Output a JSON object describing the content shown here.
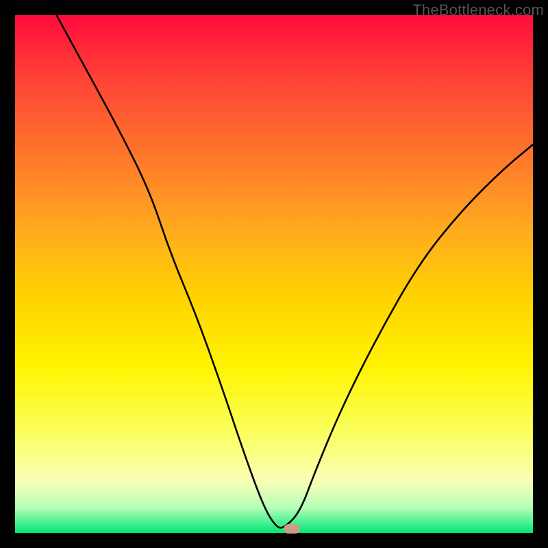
{
  "watermark": "TheBottleneck.com",
  "marker": {
    "x_frac": 0.535,
    "y_frac": 0.992
  },
  "chart_data": {
    "type": "line",
    "title": "",
    "xlabel": "",
    "ylabel": "",
    "xlim": [
      0,
      100
    ],
    "ylim": [
      0,
      100
    ],
    "grid": false,
    "legend": false,
    "series": [
      {
        "name": "bottleneck-curve",
        "x": [
          8,
          14,
          20,
          26,
          30,
          35,
          40,
          44,
          48,
          50.5,
          52,
          55,
          58,
          63,
          70,
          78,
          86,
          94,
          100
        ],
        "y": [
          100,
          89,
          78,
          66,
          54,
          42,
          28,
          16,
          5,
          1,
          1,
          4,
          12,
          24,
          38,
          52,
          62,
          70,
          75
        ]
      }
    ],
    "background_gradient": {
      "top": "#ff0b3c",
      "mid": "#fff400",
      "bottom": "#00e676"
    },
    "marker_point": {
      "x": 53.5,
      "y": 0.8
    }
  }
}
